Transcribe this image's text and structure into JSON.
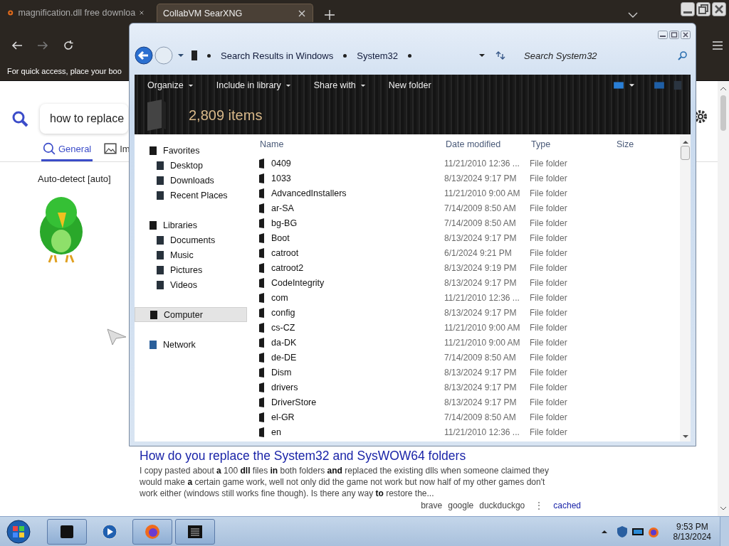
{
  "browser": {
    "tabs": [
      {
        "title": "magnification.dll free downloa",
        "selected": false
      },
      {
        "title": "CollabVM SearXNG",
        "selected": true
      }
    ],
    "bookmarks_hint": "For quick access, place your boo",
    "search": {
      "value": "how to replace"
    },
    "categories": [
      {
        "label": "General",
        "selected": true
      },
      {
        "label": "Im",
        "selected": false
      }
    ],
    "language": "Auto-detect [auto]",
    "result": {
      "title": "How do you replace the System32 and SysWOW64 folders",
      "snippet": "I copy pasted about **a** 100 **dll** files **in** both folders **and** replaced the existing dlls when someone claimed they would make **a** certain game work, well not only did the game not work but now half of my other games don't work either (windows still works fine though). Is there any way **to** restore the...",
      "engines": [
        "brave",
        "google",
        "duckduckgo"
      ],
      "menu": "⋮",
      "cached": "cached"
    }
  },
  "explorer": {
    "breadcrumbs": [
      "Search Results in Windows",
      "System32"
    ],
    "search": {
      "placeholder": "Search System32"
    },
    "commands": [
      {
        "label": "Organize",
        "dropdown": true
      },
      {
        "label": "Include in library",
        "dropdown": true
      },
      {
        "label": "Share with",
        "dropdown": true
      },
      {
        "label": "New folder",
        "dropdown": false
      }
    ],
    "item_count": "2,809 items",
    "nav": [
      {
        "label": "Favorites",
        "selected": false,
        "children": [
          {
            "label": "Desktop",
            "selected": false
          },
          {
            "label": "Downloads",
            "selected": false
          },
          {
            "label": "Recent Places",
            "selected": false
          }
        ]
      },
      {
        "label": "Libraries",
        "selected": false,
        "children": [
          {
            "label": "Documents",
            "selected": false
          },
          {
            "label": "Music",
            "selected": false
          },
          {
            "label": "Pictures",
            "selected": false
          },
          {
            "label": "Videos",
            "selected": false
          }
        ]
      },
      {
        "label": "Computer",
        "selected": true
      },
      {
        "label": "Network",
        "selected": false
      }
    ],
    "columns": [
      "Name",
      "Date modified",
      "Type",
      "Size"
    ],
    "rows": [
      {
        "name": "0409",
        "date": "11/21/2010 12:36 ...",
        "type": "File folder"
      },
      {
        "name": "1033",
        "date": "8/13/2024 9:17 PM",
        "type": "File folder"
      },
      {
        "name": "AdvancedInstallers",
        "date": "11/21/2010 9:00 AM",
        "type": "File folder"
      },
      {
        "name": "ar-SA",
        "date": "7/14/2009 8:50 AM",
        "type": "File folder"
      },
      {
        "name": "bg-BG",
        "date": "7/14/2009 8:50 AM",
        "type": "File folder"
      },
      {
        "name": "Boot",
        "date": "8/13/2024 9:17 PM",
        "type": "File folder"
      },
      {
        "name": "catroot",
        "date": "6/1/2024 9:21 PM",
        "type": "File folder"
      },
      {
        "name": "catroot2",
        "date": "8/13/2024 9:19 PM",
        "type": "File folder"
      },
      {
        "name": "CodeIntegrity",
        "date": "8/13/2024 9:17 PM",
        "type": "File folder"
      },
      {
        "name": "com",
        "date": "11/21/2010 12:36 ...",
        "type": "File folder"
      },
      {
        "name": "config",
        "date": "8/13/2024 9:17 PM",
        "type": "File folder"
      },
      {
        "name": "cs-CZ",
        "date": "11/21/2010 9:00 AM",
        "type": "File folder"
      },
      {
        "name": "da-DK",
        "date": "11/21/2010 9:00 AM",
        "type": "File folder"
      },
      {
        "name": "de-DE",
        "date": "7/14/2009 8:50 AM",
        "type": "File folder"
      },
      {
        "name": "Dism",
        "date": "8/13/2024 9:17 PM",
        "type": "File folder"
      },
      {
        "name": "drivers",
        "date": "8/13/2024 9:17 PM",
        "type": "File folder"
      },
      {
        "name": "DriverStore",
        "date": "8/13/2024 9:17 PM",
        "type": "File folder"
      },
      {
        "name": "el-GR",
        "date": "7/14/2009 8:50 AM",
        "type": "File folder"
      },
      {
        "name": "en",
        "date": "11/21/2010 12:36 ...",
        "type": "File folder"
      }
    ]
  },
  "taskbar": {
    "time": "9:53 PM",
    "date": "8/13/2024"
  }
}
